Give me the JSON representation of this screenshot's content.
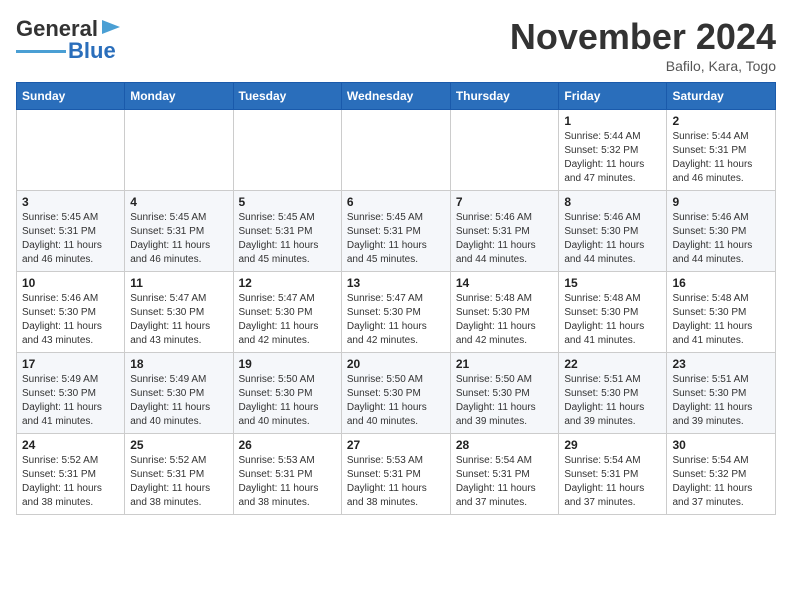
{
  "header": {
    "logo_line1": "General",
    "logo_line2": "Blue",
    "month_title": "November 2024",
    "subtitle": "Bafilo, Kara, Togo"
  },
  "days_of_week": [
    "Sunday",
    "Monday",
    "Tuesday",
    "Wednesday",
    "Thursday",
    "Friday",
    "Saturday"
  ],
  "weeks": [
    [
      {
        "day": "",
        "info": ""
      },
      {
        "day": "",
        "info": ""
      },
      {
        "day": "",
        "info": ""
      },
      {
        "day": "",
        "info": ""
      },
      {
        "day": "",
        "info": ""
      },
      {
        "day": "1",
        "info": "Sunrise: 5:44 AM\nSunset: 5:32 PM\nDaylight: 11 hours and 47 minutes."
      },
      {
        "day": "2",
        "info": "Sunrise: 5:44 AM\nSunset: 5:31 PM\nDaylight: 11 hours and 46 minutes."
      }
    ],
    [
      {
        "day": "3",
        "info": "Sunrise: 5:45 AM\nSunset: 5:31 PM\nDaylight: 11 hours and 46 minutes."
      },
      {
        "day": "4",
        "info": "Sunrise: 5:45 AM\nSunset: 5:31 PM\nDaylight: 11 hours and 46 minutes."
      },
      {
        "day": "5",
        "info": "Sunrise: 5:45 AM\nSunset: 5:31 PM\nDaylight: 11 hours and 45 minutes."
      },
      {
        "day": "6",
        "info": "Sunrise: 5:45 AM\nSunset: 5:31 PM\nDaylight: 11 hours and 45 minutes."
      },
      {
        "day": "7",
        "info": "Sunrise: 5:46 AM\nSunset: 5:31 PM\nDaylight: 11 hours and 44 minutes."
      },
      {
        "day": "8",
        "info": "Sunrise: 5:46 AM\nSunset: 5:30 PM\nDaylight: 11 hours and 44 minutes."
      },
      {
        "day": "9",
        "info": "Sunrise: 5:46 AM\nSunset: 5:30 PM\nDaylight: 11 hours and 44 minutes."
      }
    ],
    [
      {
        "day": "10",
        "info": "Sunrise: 5:46 AM\nSunset: 5:30 PM\nDaylight: 11 hours and 43 minutes."
      },
      {
        "day": "11",
        "info": "Sunrise: 5:47 AM\nSunset: 5:30 PM\nDaylight: 11 hours and 43 minutes."
      },
      {
        "day": "12",
        "info": "Sunrise: 5:47 AM\nSunset: 5:30 PM\nDaylight: 11 hours and 42 minutes."
      },
      {
        "day": "13",
        "info": "Sunrise: 5:47 AM\nSunset: 5:30 PM\nDaylight: 11 hours and 42 minutes."
      },
      {
        "day": "14",
        "info": "Sunrise: 5:48 AM\nSunset: 5:30 PM\nDaylight: 11 hours and 42 minutes."
      },
      {
        "day": "15",
        "info": "Sunrise: 5:48 AM\nSunset: 5:30 PM\nDaylight: 11 hours and 41 minutes."
      },
      {
        "day": "16",
        "info": "Sunrise: 5:48 AM\nSunset: 5:30 PM\nDaylight: 11 hours and 41 minutes."
      }
    ],
    [
      {
        "day": "17",
        "info": "Sunrise: 5:49 AM\nSunset: 5:30 PM\nDaylight: 11 hours and 41 minutes."
      },
      {
        "day": "18",
        "info": "Sunrise: 5:49 AM\nSunset: 5:30 PM\nDaylight: 11 hours and 40 minutes."
      },
      {
        "day": "19",
        "info": "Sunrise: 5:50 AM\nSunset: 5:30 PM\nDaylight: 11 hours and 40 minutes."
      },
      {
        "day": "20",
        "info": "Sunrise: 5:50 AM\nSunset: 5:30 PM\nDaylight: 11 hours and 40 minutes."
      },
      {
        "day": "21",
        "info": "Sunrise: 5:50 AM\nSunset: 5:30 PM\nDaylight: 11 hours and 39 minutes."
      },
      {
        "day": "22",
        "info": "Sunrise: 5:51 AM\nSunset: 5:30 PM\nDaylight: 11 hours and 39 minutes."
      },
      {
        "day": "23",
        "info": "Sunrise: 5:51 AM\nSunset: 5:30 PM\nDaylight: 11 hours and 39 minutes."
      }
    ],
    [
      {
        "day": "24",
        "info": "Sunrise: 5:52 AM\nSunset: 5:31 PM\nDaylight: 11 hours and 38 minutes."
      },
      {
        "day": "25",
        "info": "Sunrise: 5:52 AM\nSunset: 5:31 PM\nDaylight: 11 hours and 38 minutes."
      },
      {
        "day": "26",
        "info": "Sunrise: 5:53 AM\nSunset: 5:31 PM\nDaylight: 11 hours and 38 minutes."
      },
      {
        "day": "27",
        "info": "Sunrise: 5:53 AM\nSunset: 5:31 PM\nDaylight: 11 hours and 38 minutes."
      },
      {
        "day": "28",
        "info": "Sunrise: 5:54 AM\nSunset: 5:31 PM\nDaylight: 11 hours and 37 minutes."
      },
      {
        "day": "29",
        "info": "Sunrise: 5:54 AM\nSunset: 5:31 PM\nDaylight: 11 hours and 37 minutes."
      },
      {
        "day": "30",
        "info": "Sunrise: 5:54 AM\nSunset: 5:32 PM\nDaylight: 11 hours and 37 minutes."
      }
    ]
  ]
}
